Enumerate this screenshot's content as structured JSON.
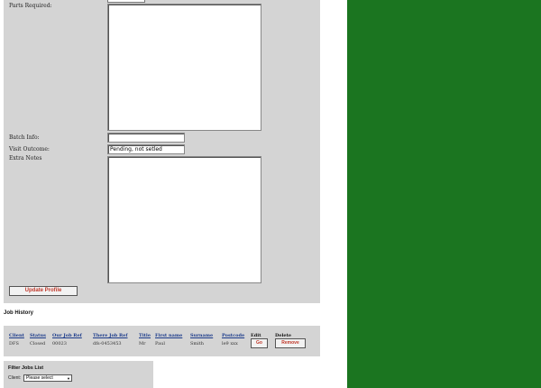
{
  "form": {
    "parts_label": "Parts Required:",
    "batch_label": "Batch Info:",
    "batch_value": "",
    "outcome_label": "Visit Outcome:",
    "outcome_value": "Pending, not setled",
    "extra_label": "Extra Notes",
    "update_button": "Update Profile"
  },
  "history": {
    "heading": "Job History",
    "columns": [
      "Client",
      "Status",
      "Our Job Ref",
      "There Job Ref",
      "Title",
      "First name",
      "Surname",
      "Postcode",
      "Edit",
      "Delete"
    ],
    "row": {
      "client": "DFS",
      "status": "Closed",
      "our_ref": "00023",
      "their_ref": "dfs-0453453",
      "title": "Mr",
      "first_name": "Paul",
      "surname": "Smith",
      "postcode": "le9 xxx",
      "go_button": "Go",
      "remove_button": "Remove"
    }
  },
  "filter": {
    "heading": "Filter Jobs List",
    "client_label": "Client:",
    "client_select": "Please select"
  },
  "colors": {
    "sidebar": "#1b7520",
    "panel": "#d4d4d4",
    "button_text": "#c0392b",
    "link": "#1a3a8a"
  }
}
